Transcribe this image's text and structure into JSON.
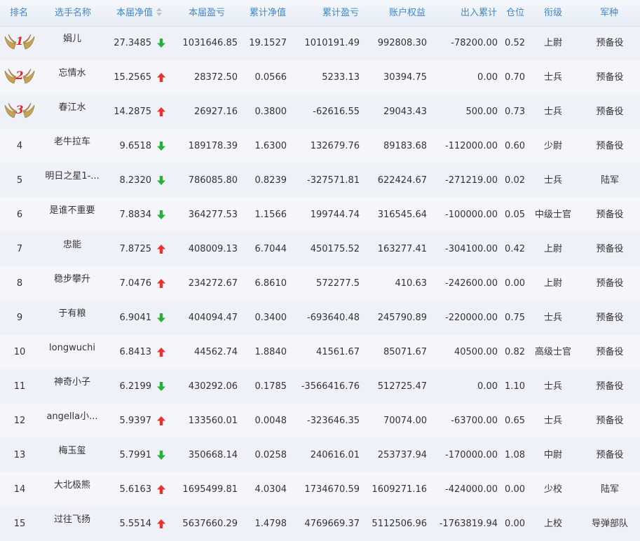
{
  "header": {
    "rank": "排名",
    "name": "选手名称",
    "nav": "本届净值",
    "pnl": "本届盈亏",
    "cum_nav": "累计净值",
    "cum_pnl": "累计盈亏",
    "equity": "账户权益",
    "flow": "出入累计",
    "position": "仓位",
    "title": "衔级",
    "branch": "军种"
  },
  "colors": {
    "header_text": "#3f86cf",
    "up": "#e8322d",
    "down": "#2aae3a"
  },
  "rows": [
    {
      "rank": "1",
      "name": "娟儿",
      "nav": "27.3485",
      "trend": "down",
      "pnl": "1031646.85",
      "cum_nav": "19.1527",
      "cum_pnl": "1010191.49",
      "equity": "992808.30",
      "flow": "-78200.00",
      "position": "0.52",
      "title": "上尉",
      "branch": "预备役"
    },
    {
      "rank": "2",
      "name": "忘情水",
      "nav": "15.2565",
      "trend": "up",
      "pnl": "28372.50",
      "cum_nav": "0.0566",
      "cum_pnl": "5233.13",
      "equity": "30394.75",
      "flow": "0.00",
      "position": "0.70",
      "title": "士兵",
      "branch": "预备役"
    },
    {
      "rank": "3",
      "name": "春江水",
      "nav": "14.2875",
      "trend": "up",
      "pnl": "26927.16",
      "cum_nav": "0.3800",
      "cum_pnl": "-62616.55",
      "equity": "29043.43",
      "flow": "500.00",
      "position": "0.73",
      "title": "士兵",
      "branch": "预备役"
    },
    {
      "rank": "4",
      "name": "老牛拉车",
      "nav": "9.6518",
      "trend": "down",
      "pnl": "189178.39",
      "cum_nav": "1.6300",
      "cum_pnl": "132679.76",
      "equity": "89183.68",
      "flow": "-112000.00",
      "position": "0.60",
      "title": "少尉",
      "branch": "预备役"
    },
    {
      "rank": "5",
      "name": "明日之星1-...",
      "nav": "8.2320",
      "trend": "down",
      "pnl": "786085.80",
      "cum_nav": "0.8239",
      "cum_pnl": "-327571.81",
      "equity": "622424.67",
      "flow": "-271219.00",
      "position": "0.02",
      "title": "士兵",
      "branch": "陆军"
    },
    {
      "rank": "6",
      "name": "是谁不重要",
      "nav": "7.8834",
      "trend": "down",
      "pnl": "364277.53",
      "cum_nav": "1.1566",
      "cum_pnl": "199744.74",
      "equity": "316545.64",
      "flow": "-100000.00",
      "position": "0.05",
      "title": "中级士官",
      "branch": "预备役"
    },
    {
      "rank": "7",
      "name": "忠能",
      "nav": "7.8725",
      "trend": "up",
      "pnl": "408009.13",
      "cum_nav": "6.7044",
      "cum_pnl": "450175.52",
      "equity": "163277.41",
      "flow": "-304100.00",
      "position": "0.42",
      "title": "上尉",
      "branch": "预备役"
    },
    {
      "rank": "8",
      "name": "稳步攀升",
      "nav": "7.0476",
      "trend": "up",
      "pnl": "234272.67",
      "cum_nav": "6.8610",
      "cum_pnl": "572277.5",
      "equity": "410.63",
      "flow": "-242600.00",
      "position": "0.00",
      "title": "上尉",
      "branch": "预备役"
    },
    {
      "rank": "9",
      "name": "于有粮",
      "nav": "6.9041",
      "trend": "down",
      "pnl": "404094.47",
      "cum_nav": "0.3400",
      "cum_pnl": "-693640.48",
      "equity": "245790.89",
      "flow": "-220000.00",
      "position": "0.75",
      "title": "士兵",
      "branch": "预备役"
    },
    {
      "rank": "10",
      "name": "longwuchi",
      "nav": "6.8413",
      "trend": "up",
      "pnl": "44562.74",
      "cum_nav": "1.8840",
      "cum_pnl": "41561.67",
      "equity": "85071.67",
      "flow": "40500.00",
      "position": "0.82",
      "title": "高级士官",
      "branch": "预备役"
    },
    {
      "rank": "11",
      "name": "神奇小子",
      "nav": "6.2199",
      "trend": "down",
      "pnl": "430292.06",
      "cum_nav": "0.1785",
      "cum_pnl": "-3566416.76",
      "equity": "512725.47",
      "flow": "0.00",
      "position": "1.10",
      "title": "士兵",
      "branch": "预备役"
    },
    {
      "rank": "12",
      "name": "angella小...",
      "nav": "5.9397",
      "trend": "up",
      "pnl": "133560.01",
      "cum_nav": "0.0048",
      "cum_pnl": "-323646.35",
      "equity": "70074.00",
      "flow": "-63700.00",
      "position": "0.65",
      "title": "士兵",
      "branch": "预备役"
    },
    {
      "rank": "13",
      "name": "梅玉玺",
      "nav": "5.7991",
      "trend": "down",
      "pnl": "350668.14",
      "cum_nav": "0.0258",
      "cum_pnl": "240616.01",
      "equity": "253737.94",
      "flow": "-170000.00",
      "position": "1.08",
      "title": "中尉",
      "branch": "预备役"
    },
    {
      "rank": "14",
      "name": "大北极熊",
      "nav": "5.6163",
      "trend": "up",
      "pnl": "1695499.81",
      "cum_nav": "4.0304",
      "cum_pnl": "1734670.59",
      "equity": "1609271.16",
      "flow": "-424000.00",
      "position": "0.00",
      "title": "少校",
      "branch": "陆军"
    },
    {
      "rank": "15",
      "name": "过往飞扬",
      "nav": "5.5514",
      "trend": "up",
      "pnl": "5637660.29",
      "cum_nav": "1.4798",
      "cum_pnl": "4769669.37",
      "equity": "5112506.96",
      "flow": "-1763819.94",
      "position": "0.00",
      "title": "上校",
      "branch": "导弹部队"
    }
  ]
}
